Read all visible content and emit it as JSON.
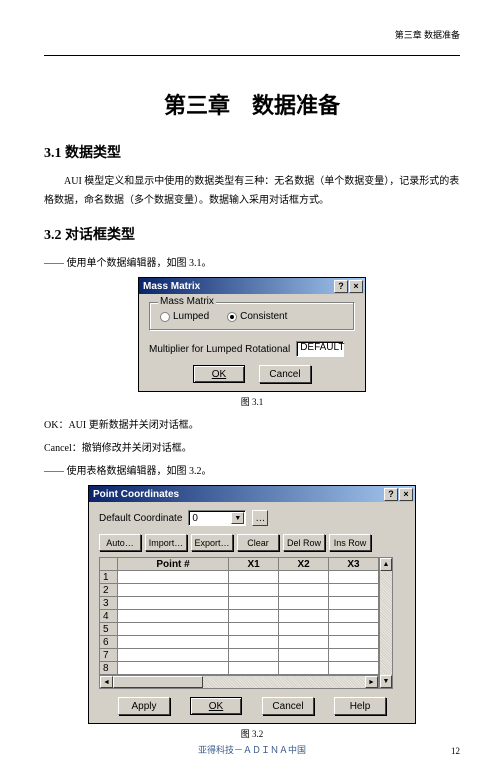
{
  "header": {
    "right": "第三章 数据准备"
  },
  "chapter_title": "第三章　数据准备",
  "sec1": {
    "heading": "3.1 数据类型",
    "para": "AUI 模型定义和显示中使用的数据类型有三种：无名数据（单个数据变量），记录形式的表格数据，命名数据（多个数据变量）。数据输入采用对话框方式。"
  },
  "sec2": {
    "heading": "3.2 对话框类型",
    "para1": "使用单个数据编辑器，如图 3.1。",
    "ok_line": "OK：AUI 更新数据并关闭对话框。",
    "cancel_line": "Cancel：撤销修改并关闭对话框。",
    "para2": "使用表格数据编辑器，如图 3.2。"
  },
  "fig1": {
    "title": "Mass Matrix",
    "group_label": "Mass Matrix",
    "radio_lumped": "Lumped",
    "radio_consistent": "Consistent",
    "mult_label": "Multiplier for Lumped Rotational",
    "mult_value": "DEFAULT",
    "ok": "OK",
    "cancel": "Cancel",
    "caption": "图 3.1"
  },
  "fig2": {
    "title": "Point Coordinates",
    "default_label": "Default Coordinate",
    "default_value": "0",
    "buttons": {
      "auto": "Auto…",
      "import": "Import…",
      "export": "Export…",
      "clear": "Clear",
      "delrow": "Del Row",
      "insrow": "Ins Row"
    },
    "columns": [
      "Point #",
      "X1",
      "X2",
      "X3"
    ],
    "rows": [
      "1",
      "2",
      "3",
      "4",
      "5",
      "6",
      "7",
      "8"
    ],
    "apply": "Apply",
    "ok": "OK",
    "cancel": "Cancel",
    "help": "Help",
    "caption": "图 3.2"
  },
  "footer": "亚得科技－ＡＤＩＮＡ中国",
  "page_num": "12",
  "chart_data": {
    "type": "table",
    "title": "Point Coordinates",
    "columns": [
      "Point #",
      "X1",
      "X2",
      "X3"
    ],
    "rows": [
      {
        "Point #": 1,
        "X1": null,
        "X2": null,
        "X3": null
      },
      {
        "Point #": 2,
        "X1": null,
        "X2": null,
        "X3": null
      },
      {
        "Point #": 3,
        "X1": null,
        "X2": null,
        "X3": null
      },
      {
        "Point #": 4,
        "X1": null,
        "X2": null,
        "X3": null
      },
      {
        "Point #": 5,
        "X1": null,
        "X2": null,
        "X3": null
      },
      {
        "Point #": 6,
        "X1": null,
        "X2": null,
        "X3": null
      },
      {
        "Point #": 7,
        "X1": null,
        "X2": null,
        "X3": null
      },
      {
        "Point #": 8,
        "X1": null,
        "X2": null,
        "X3": null
      }
    ]
  }
}
